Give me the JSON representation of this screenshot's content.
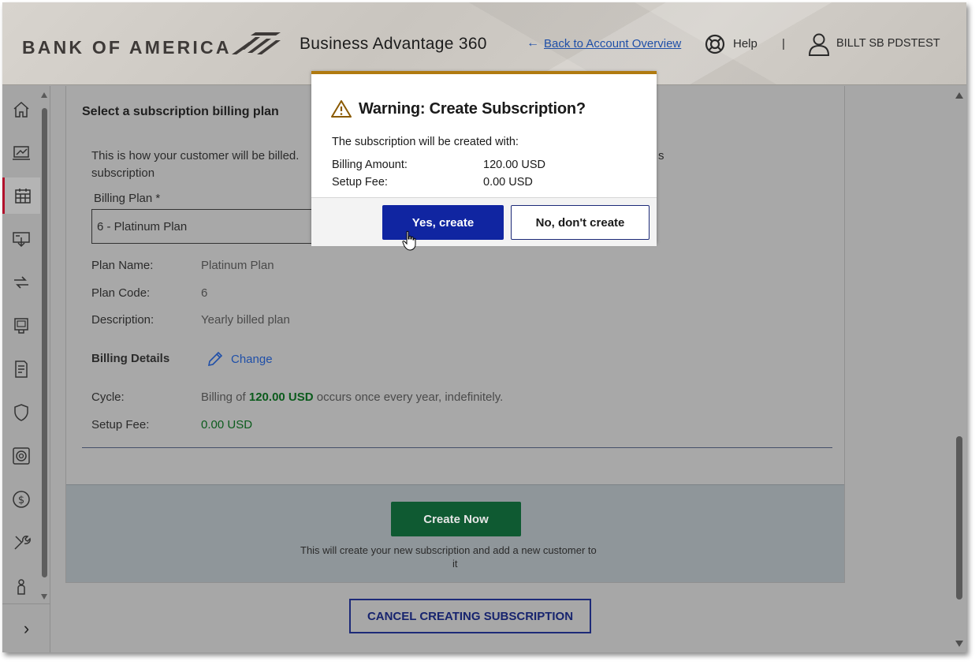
{
  "header": {
    "brand": "BANK OF AMERICA",
    "product": "Business Advantage 360",
    "back_link": "Back to Account Overview",
    "help": "Help",
    "separator": "|",
    "user": "BILLT SB PDSTEST"
  },
  "sidebar": {
    "items": [
      "home-icon",
      "dashboard-icon",
      "calendar-icon",
      "deposit-icon",
      "transfer-icon",
      "terminal-icon",
      "document-icon",
      "shield-icon",
      "vault-icon",
      "dollar-icon",
      "tools-icon",
      "person-icon"
    ],
    "active_item": "calendar-icon",
    "expand_glyph": "›"
  },
  "form": {
    "section_title": "Select a subscription billing plan",
    "intro_line1": "This is how your customer will be billed.",
    "intro_line1_tail": "s",
    "intro_line2": "subscription",
    "billing_plan_label": "Billing Plan *",
    "billing_plan_value": "6 - Platinum Plan",
    "plan_name_label": "Plan Name:",
    "plan_name_value": "Platinum Plan",
    "plan_code_label": "Plan Code:",
    "plan_code_value": "6",
    "description_label": "Description:",
    "description_value": "Yearly billed plan",
    "billing_details_label": "Billing Details",
    "change_link": "Change",
    "cycle_label": "Cycle:",
    "cycle_prefix": "Billing of ",
    "cycle_amount": "120.00 USD",
    "cycle_suffix": " occurs once every year, indefinitely.",
    "setup_fee_label": "Setup Fee:",
    "setup_fee_value": "0.00 USD",
    "create_button": "Create Now",
    "create_note_line1": "This will create your new subscription and add a new customer to",
    "create_note_line2": "it",
    "cancel_button": "CANCEL CREATING SUBSCRIPTION"
  },
  "modal": {
    "title": "Warning: Create Subscription?",
    "intro": "The subscription will be created with:",
    "billing_amount_label": "Billing Amount:",
    "billing_amount_value": "120.00 USD",
    "setup_fee_label": "Setup Fee:",
    "setup_fee_value": "0.00 USD",
    "yes_button": "Yes, create",
    "no_button": "No, don't create"
  },
  "colors": {
    "accent_red": "#b1102b",
    "primary_blue": "#1025a1",
    "create_green": "#0f5a32",
    "amount_green": "#0b5b1c",
    "warning_gold": "#b07a10",
    "link_blue": "#1f4fa8"
  }
}
